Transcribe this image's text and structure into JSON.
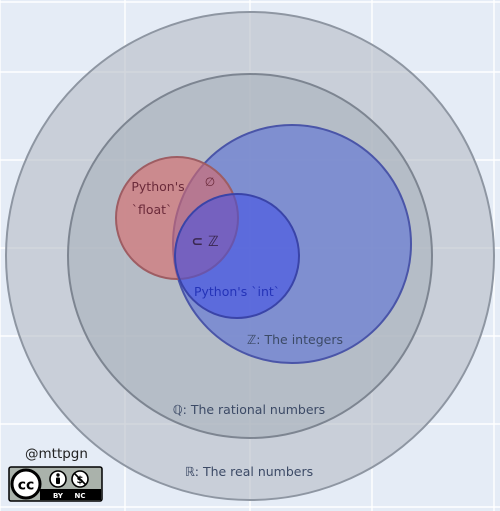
{
  "diagram": {
    "sets": [
      {
        "id": "reals",
        "label": "ℝ: The real numbers",
        "fill": "#b6bcc6",
        "stroke": "#8e96a2"
      },
      {
        "id": "rationals",
        "label": "ℚ: The rational numbers",
        "fill": "#a9b0bb",
        "stroke": "#7d8591"
      },
      {
        "id": "integers",
        "label": "ℤ: The integers",
        "fill": "#5b6fd6",
        "stroke": "#4a55a8"
      },
      {
        "id": "python_float",
        "label_line1": "Python's",
        "label_line2": "`float`",
        "fill": "#d96a6a",
        "stroke": "#9e5d63"
      },
      {
        "id": "python_int",
        "label": "Python's `int`",
        "fill": "#3f4fe6",
        "stroke": "#3a44a8"
      }
    ],
    "annotations": {
      "empty_set": "∅",
      "subset_of_integers": "⊂ ℤ"
    },
    "colors": {
      "background": "#e5ecf6",
      "grid": "#ffffff",
      "label_text": "#3c4a66",
      "int_text": "#2433b8",
      "float_text": "#6b2a3a",
      "overlap_text": "#3a2850"
    }
  },
  "author": {
    "handle": "@mttpgn"
  },
  "license": {
    "logo_text": "cc",
    "by": "BY",
    "nc": "NC"
  }
}
